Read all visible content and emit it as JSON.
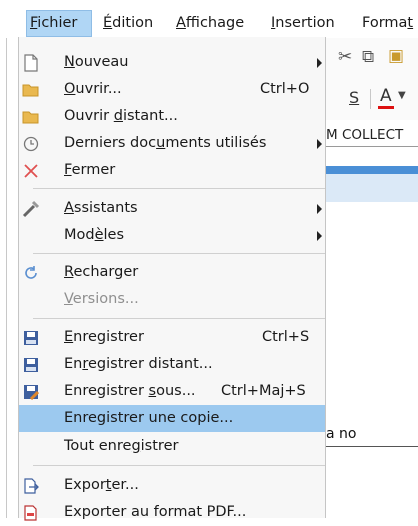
{
  "menubar": {
    "items": [
      {
        "pre": "",
        "acc": "F",
        "post": "ichier",
        "active": true
      },
      {
        "pre": "",
        "acc": "É",
        "post": "dition"
      },
      {
        "pre": "",
        "acc": "A",
        "post": "ffichage"
      },
      {
        "pre": "",
        "acc": "I",
        "post": "nsertion"
      },
      {
        "pre": "Forma",
        "acc": "t",
        "post": ""
      }
    ]
  },
  "background": {
    "sheet_header": "M COLLECT",
    "toolbar_s": "S",
    "toolbar_a": "A",
    "cell_text": "a no"
  },
  "menu": {
    "items": [
      {
        "icon": "new-document-icon",
        "pre": "",
        "acc": "N",
        "post": "ouveau",
        "submenu": true
      },
      {
        "icon": "open-folder-icon",
        "pre": "",
        "acc": "O",
        "post": "uvrir...",
        "shortcut": "Ctrl+O"
      },
      {
        "icon": "remote-folder-icon",
        "pre": "Ouvrir ",
        "acc": "d",
        "post": "istant..."
      },
      {
        "icon": "recent-clock-icon",
        "pre": "Derniers doc",
        "acc": "u",
        "post": "ments utilisés",
        "submenu": true
      },
      {
        "icon": "close-x-icon",
        "pre": "",
        "acc": "F",
        "post": "ermer"
      },
      {
        "icon": "wizard-icon",
        "pre": "",
        "acc": "A",
        "post": "ssistants",
        "submenu": true
      },
      {
        "icon": "",
        "pre": "Mod",
        "acc": "è",
        "post": "les",
        "submenu": true
      },
      {
        "icon": "reload-icon",
        "pre": "",
        "acc": "R",
        "post": "echarger"
      },
      {
        "icon": "",
        "pre": "",
        "acc": "V",
        "post": "ersions...",
        "disabled": true
      },
      {
        "icon": "save-icon",
        "pre": "",
        "acc": "E",
        "post": "nregistrer",
        "shortcut": "Ctrl+S"
      },
      {
        "icon": "save-remote-icon",
        "pre": "En",
        "acc": "r",
        "post": "egistrer distant..."
      },
      {
        "icon": "save-as-icon",
        "pre": "Enregistrer ",
        "acc": "s",
        "post": "ous...",
        "shortcut": "Ctrl+Maj+S"
      },
      {
        "icon": "",
        "pre": "Enregistrer une copie...",
        "acc": "",
        "post": "",
        "highlighted": true
      },
      {
        "icon": "",
        "pre": "Tout enre",
        "acc": "g",
        "post": "istrer"
      },
      {
        "icon": "export-icon",
        "pre": "Expor",
        "acc": "t",
        "post": "er..."
      },
      {
        "icon": "export-pdf-icon",
        "pre": "Exporter au format PDF...",
        "acc": "",
        "post": ""
      }
    ]
  }
}
